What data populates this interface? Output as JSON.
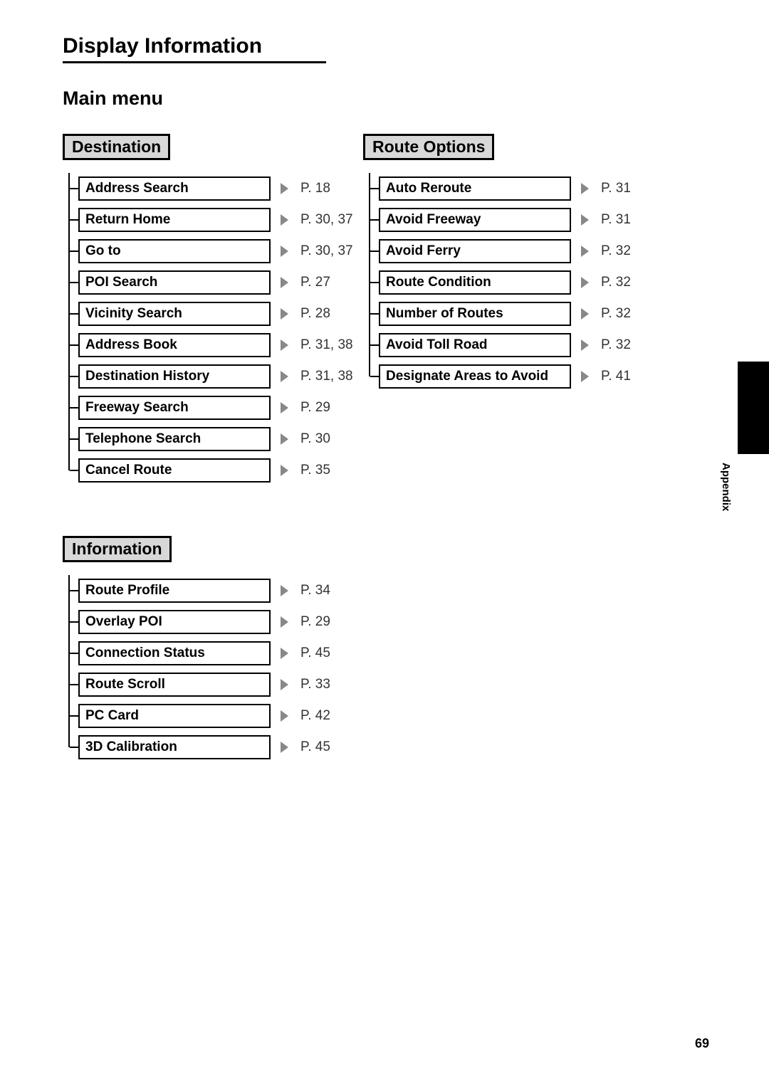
{
  "title": "Display Information",
  "subtitle": "Main menu",
  "side_tab": "Appendix",
  "page_number": "69",
  "sections": {
    "destination": {
      "header": "Destination",
      "items": [
        {
          "label": "Address Search",
          "page": "P. 18"
        },
        {
          "label": "Return Home",
          "page": "P. 30, 37"
        },
        {
          "label": "Go to",
          "page": "P. 30, 37"
        },
        {
          "label": "POI Search",
          "page": "P. 27"
        },
        {
          "label": "Vicinity Search",
          "page": "P. 28"
        },
        {
          "label": "Address Book",
          "page": "P. 31, 38"
        },
        {
          "label": "Destination History",
          "page": "P. 31, 38"
        },
        {
          "label": "Freeway Search",
          "page": "P. 29"
        },
        {
          "label": "Telephone Search",
          "page": "P. 30"
        },
        {
          "label": "Cancel Route",
          "page": "P. 35"
        }
      ]
    },
    "route_options": {
      "header": "Route Options",
      "items": [
        {
          "label": "Auto Reroute",
          "page": "P. 31"
        },
        {
          "label": "Avoid Freeway",
          "page": "P. 31"
        },
        {
          "label": "Avoid Ferry",
          "page": "P. 32"
        },
        {
          "label": "Route Condition",
          "page": "P. 32"
        },
        {
          "label": "Number of Routes",
          "page": "P. 32"
        },
        {
          "label": "Avoid Toll Road",
          "page": "P. 32"
        },
        {
          "label": "Designate Areas to Avoid",
          "page": "P. 41"
        }
      ]
    },
    "information": {
      "header": "Information",
      "items": [
        {
          "label": "Route Profile",
          "page": "P. 34"
        },
        {
          "label": "Overlay POI",
          "page": "P. 29"
        },
        {
          "label": "Connection Status",
          "page": "P. 45"
        },
        {
          "label": "Route Scroll",
          "page": "P. 33"
        },
        {
          "label": "PC Card",
          "page": "P. 42"
        },
        {
          "label": "3D Calibration",
          "page": "P. 45"
        }
      ]
    }
  }
}
